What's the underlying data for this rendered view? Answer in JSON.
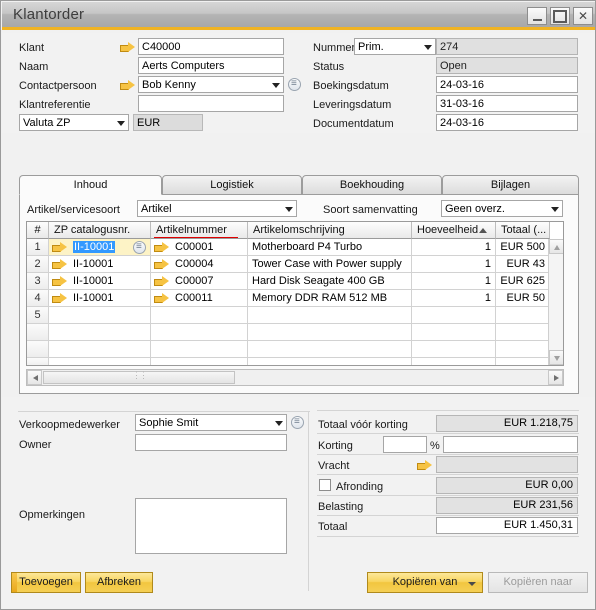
{
  "window": {
    "title": "Klantorder",
    "controls": {
      "minimize": "–",
      "maximize": "□",
      "close": "✕"
    }
  },
  "header_left": [
    {
      "label": "Klant",
      "value": "C40000",
      "has_arrow": true,
      "type": "text"
    },
    {
      "label": "Naam",
      "value": "Aerts Computers",
      "has_arrow": false,
      "type": "text"
    },
    {
      "label": "Contactpersoon",
      "value": "Bob Kenny",
      "has_arrow": true,
      "type": "combo"
    },
    {
      "label": "Klantreferentie",
      "value": "",
      "has_arrow": false,
      "type": "text"
    }
  ],
  "valuta": {
    "label": "Valuta ZP",
    "value": "EUR"
  },
  "header_right": [
    {
      "label": "Nummer",
      "select": "Prim.",
      "value": "274",
      "readonly": true
    },
    {
      "label": "Status",
      "select": "",
      "value": "Open",
      "readonly": true
    },
    {
      "label": "Boekingsdatum",
      "select": "",
      "value": "24-03-16",
      "readonly": false
    },
    {
      "label": "Leveringsdatum",
      "select": "",
      "value": "31-03-16",
      "readonly": false
    },
    {
      "label": "Documentdatum",
      "select": "",
      "value": "24-03-16",
      "readonly": false
    }
  ],
  "tabs": [
    {
      "label": "Inhoud",
      "active": true
    },
    {
      "label": "Logistiek",
      "active": false
    },
    {
      "label": "Boekhouding",
      "active": false
    },
    {
      "label": "Bijlagen",
      "active": false
    }
  ],
  "filters": {
    "artikel_label": "Artikel/servicesoort",
    "artikel_value": "Artikel",
    "samenvatting_label": "Soort samenvatting",
    "samenvatting_value": "Geen overz."
  },
  "grid": {
    "columns": [
      {
        "key": "num",
        "label": "#"
      },
      {
        "key": "cat",
        "label": "ZP catalogusnr."
      },
      {
        "key": "art",
        "label": "Artikelnummer",
        "underlined": true
      },
      {
        "key": "desc",
        "label": "Artikelomschrijving"
      },
      {
        "key": "qty",
        "label": "Hoeveelheid",
        "sorted": "asc"
      },
      {
        "key": "total",
        "label": "Totaal (..."
      }
    ],
    "rows": [
      {
        "num": "1",
        "cat": "II-10001",
        "art": "C00001",
        "desc": "Motherboard P4 Turbo",
        "qty": "1",
        "total": "EUR 500"
      },
      {
        "num": "2",
        "cat": "II-10001",
        "art": "C00004",
        "desc": "Tower Case with Power supply",
        "qty": "1",
        "total": "EUR 43"
      },
      {
        "num": "3",
        "cat": "II-10001",
        "art": "C00007",
        "desc": "Hard Disk Seagate 400 GB",
        "qty": "1",
        "total": "EUR 625"
      },
      {
        "num": "4",
        "cat": "II-10001",
        "art": "C00011",
        "desc": "Memory DDR RAM 512 MB",
        "qty": "1",
        "total": "EUR 50"
      },
      {
        "num": "5",
        "cat": "",
        "art": "",
        "desc": "",
        "qty": "",
        "total": ""
      }
    ],
    "selected_row": 1,
    "selected_cell": "cat"
  },
  "footer_left": {
    "verkoopmedewerker_label": "Verkoopmedewerker",
    "verkoopmedewerker_value": "Sophie Smit",
    "owner_label": "Owner",
    "owner_value": "",
    "opmerkingen_label": "Opmerkingen",
    "opmerkingen_value": ""
  },
  "totals": [
    {
      "label": "Totaal vóór korting",
      "value": "EUR 1.218,75",
      "style": "ro"
    },
    {
      "label": "Korting",
      "value": "",
      "style": "wh",
      "suffix": "%"
    },
    {
      "label": "Vracht",
      "value": "",
      "style": "ro",
      "arrow": true
    },
    {
      "label": "Afronding",
      "value": "EUR 0,00",
      "style": "ro",
      "checkbox": true
    },
    {
      "label": "Belasting",
      "value": "EUR 231,56",
      "style": "ro"
    },
    {
      "label": "Totaal",
      "value": "EUR 1.450,31",
      "style": "wh"
    }
  ],
  "buttons": {
    "toevoegen": "Toevoegen",
    "afbreken": "Afbreken",
    "kopieren_van": "Kopiëren van",
    "kopieren_naar": "Kopiëren naar"
  },
  "colors": {
    "accent": "#f0b323",
    "button": "#f5cf55",
    "selection": "#3399ff",
    "row_highlight": "#fdf3c6",
    "underline": "#e00000"
  }
}
